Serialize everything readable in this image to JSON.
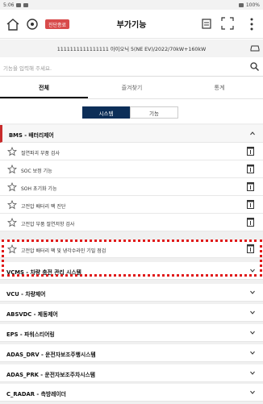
{
  "status_bar": {
    "time": "5:06",
    "battery": "100%"
  },
  "app_bar": {
    "badge": "진단종료",
    "title": "부가기능"
  },
  "vehicle_bar": {
    "info": "1111111111111111 아이오닉 5(NE EV)/2022/70kW+160kW"
  },
  "search": {
    "placeholder": "기능을 입력해 주세요."
  },
  "tabs": [
    {
      "label": "전체",
      "active": true
    },
    {
      "label": "즐겨찾기",
      "active": false
    },
    {
      "label": "통계",
      "active": false
    }
  ],
  "segment": {
    "system_label": "시스템",
    "function_label": "기능",
    "selected": "시스템"
  },
  "sections": [
    {
      "label": "BMS - 배터리제어",
      "expanded": true
    },
    {
      "label": "VCMS - 차량 충전 관리 시스템",
      "expanded": false
    },
    {
      "label": "VCU - 차량제어",
      "expanded": false
    },
    {
      "label": "ABSVDC - 제동제어",
      "expanded": false
    },
    {
      "label": "EPS - 파워스티어링",
      "expanded": false
    },
    {
      "label": "ADAS_DRV - 운전자보조주행시스템",
      "expanded": false
    },
    {
      "label": "ADAS_PRK - 운전자보조주차시스템",
      "expanded": false
    },
    {
      "label": "C_RADAR - 측방레이더",
      "expanded": false
    }
  ],
  "bms_items": [
    {
      "label": "절연파괴 부품 검사"
    },
    {
      "label": "SOC 보정 기능"
    },
    {
      "label": "SOH 초기화 기능"
    },
    {
      "label": "고전압 배터리 팩 진단"
    },
    {
      "label": "고전압 부품 절연저항 검사"
    },
    {
      "label": "고전압 배터리 팩 및 냉각수라인 기밀 점검"
    }
  ],
  "colors": {
    "accent_red": "#c82b2b",
    "navy": "#0c2e58",
    "badge_red": "#d84b4b",
    "highlight_red": "#e01818"
  }
}
